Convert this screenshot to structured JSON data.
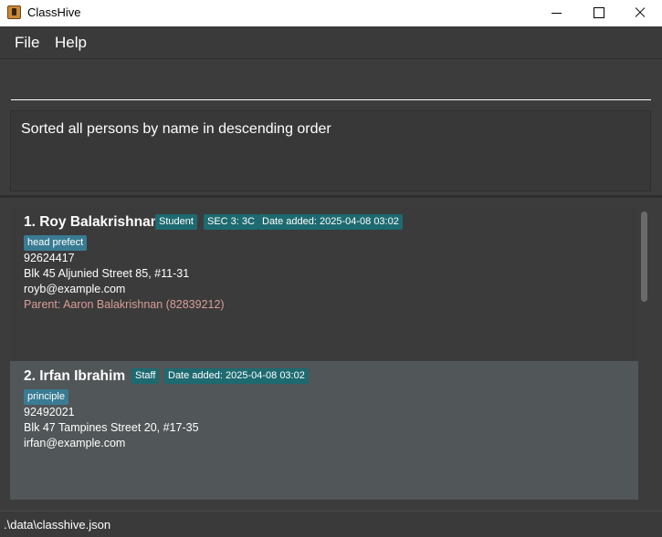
{
  "window": {
    "title": "ClassHive"
  },
  "menu": {
    "file": "File",
    "help": "Help"
  },
  "command": {
    "value": ""
  },
  "result": {
    "message": "Sorted all persons by name in descending order"
  },
  "persons": [
    {
      "name": "1. Roy Balakrishnan",
      "badges": [
        "Student",
        "SEC 3: 3C",
        "Date added: 2025-04-08 03:02"
      ],
      "tag": "head prefect",
      "phone": "92624417",
      "address": "Blk 45 Aljunied Street 85, #11-31",
      "email": "royb@example.com",
      "parent": "Parent: Aaron Balakrishnan (82839212)"
    },
    {
      "name": "2. Irfan Ibrahim",
      "badges": [
        "Staff",
        "Date added: 2025-04-08 03:02"
      ],
      "tag": "principle",
      "phone": "92492021",
      "address": "Blk 47 Tampines Street 20, #17-35",
      "email": "irfan@example.com"
    }
  ],
  "status": {
    "path": ".\\data\\classhive.json"
  },
  "colors": {
    "badge": "#1d6a70",
    "tag": "#3a7b94",
    "parent_text": "#d89c99",
    "selected_card": "#515658"
  }
}
